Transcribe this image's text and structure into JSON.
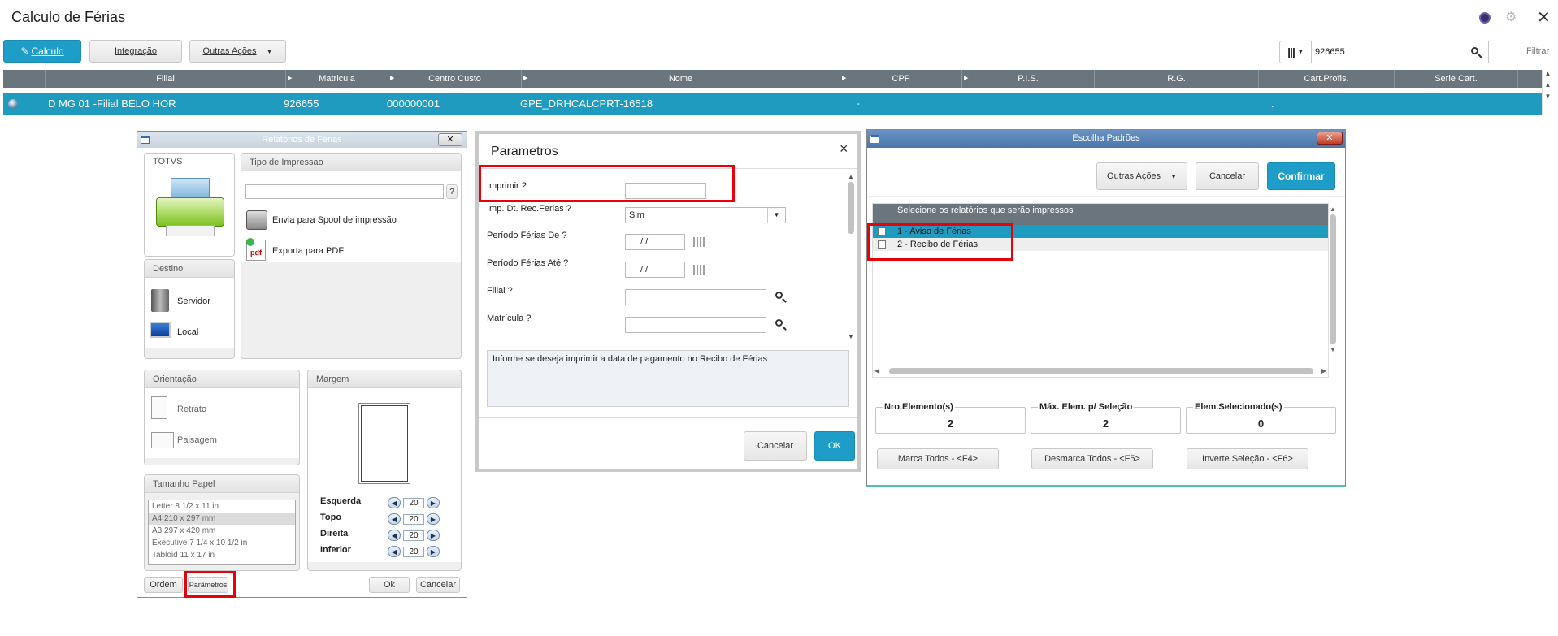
{
  "app": {
    "title": "Calculo de Férias"
  },
  "toolbar": {
    "calculo": "Calculo",
    "integracao": "Integração",
    "outras_acoes": "Outras Ações",
    "search_value": "926655",
    "filtrar": "Filtrar"
  },
  "grid": {
    "columns": [
      "Filial",
      "Matricula",
      "Centro Custo",
      "Nome",
      "CPF",
      "P.I.S.",
      "R.G.",
      "Cart.Profis.",
      "Serie Cart."
    ],
    "row": {
      "filial": "D MG 01 -Filial BELO HOR",
      "matricula": "926655",
      "centro_custo": "000000001",
      "nome": "GPE_DRHCALCPRT-16518",
      "cpf": ". .  -",
      "cart": "."
    }
  },
  "relatorios": {
    "title": "Relatórios de Férias",
    "totvs": "TOTVS",
    "tipo_impressao": "Tipo de Impressao",
    "help": "?",
    "opt_spool": "Envia para Spool de impressão",
    "opt_pdf": "Exporta para PDF",
    "pdf_icon": "pdf",
    "destino": "Destino",
    "servidor": "Servidor",
    "local": "Local",
    "orientacao": "Orientação",
    "retrato": "Retrato",
    "paisagem": "Paisagem",
    "margem": "Margem",
    "tamanho_papel": "Tamanho Papel",
    "papers": [
      "Letter 8 1/2 x 11 in",
      "A4 210 x 297 mm",
      "A3 297 x 420 mm",
      "Executive 7 1/4 x 10 1/2 in",
      "Tabloid 11 x 17 in"
    ],
    "margins": [
      {
        "label": "Esquerda",
        "value": "20"
      },
      {
        "label": "Topo",
        "value": "20"
      },
      {
        "label": "Direita",
        "value": "20"
      },
      {
        "label": "Inferior",
        "value": "20"
      }
    ],
    "ordem": "Ordem",
    "parametros": "Parâmetros",
    "ok": "Ok",
    "cancelar": "Cancelar"
  },
  "parametros": {
    "title": "Parametros",
    "close": "×",
    "fields": [
      {
        "label": "Imprimir ?",
        "value": ""
      },
      {
        "label": "Imp. Dt. Rec.Ferias ?",
        "value": "Sim"
      },
      {
        "label": "Período Férias De ?",
        "value": "  /  /"
      },
      {
        "label": "Período Férias Até ?",
        "value": "  /  /"
      },
      {
        "label": "Filial ?",
        "value": ""
      },
      {
        "label": "Matrícula ?",
        "value": ""
      }
    ],
    "hint": "Informe se deseja imprimir a data de pagamento no Recibo de Férias",
    "cancelar": "Cancelar",
    "ok": "OK"
  },
  "escolha": {
    "title": "Escolha Padrões",
    "outras_acoes": "Outras Ações",
    "cancelar": "Cancelar",
    "confirmar": "Confirmar",
    "header": "Selecione os relatórios que serão impressos",
    "items": [
      "1 - Aviso de Férias",
      "2 - Recibo de Férias"
    ],
    "nro_label": "Nro.Elemento(s)",
    "nro_value": "2",
    "max_label": "Máx. Elem. p/ Seleção",
    "max_value": "2",
    "sel_label": "Elem.Selecionado(s)",
    "sel_value": "0",
    "marca": "Marca Todos - <F4>",
    "desmarca": "Desmarca Todos - <F5>",
    "inverte": "Inverte Seleção - <F6>"
  },
  "colors": {
    "accent": "#1e9dc8",
    "grid_header": "#6b757d",
    "row_selected": "#1e9bbf",
    "highlight": "#e8000b"
  }
}
